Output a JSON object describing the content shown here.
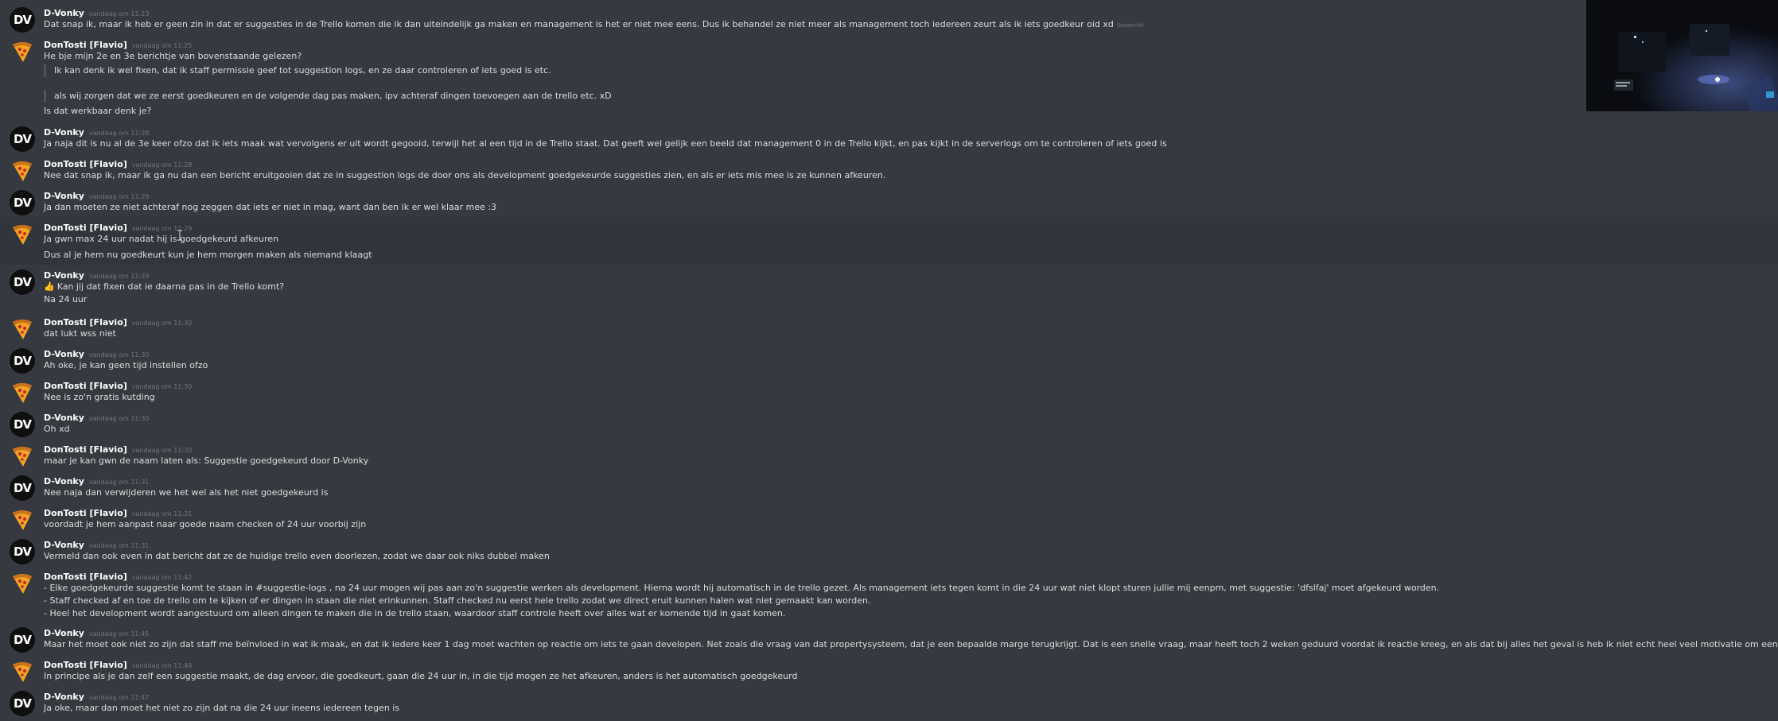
{
  "authors": {
    "dv": {
      "name": "D-Vonky",
      "avatar": "DV"
    },
    "df": {
      "name": "DonTosti [Flavio]",
      "avatar": "pizza-icon"
    }
  },
  "messages": [
    {
      "author": "D-Vonky",
      "time": "vandaag om 11:23",
      "lines": [
        "Dat snap ik, maar ik heb er geen zin in dat er suggesties in de Trello komen die ik dan uiteindelijk ga maken en management is het er niet mee eens. Dus ik behandel ze niet meer als management toch iedereen zeurt als ik iets goedkeur oid xd"
      ],
      "edited": "(bewerkt)"
    },
    {
      "author": "DonTosti [Flavio]",
      "time": "vandaag om 11:25",
      "lines": [
        "He bje mijn 2e en 3e berichtje van bovenstaande gelezen?"
      ],
      "quotes": [
        "Ik kan denk ik wel fixen, dat ik staff permissie geef tot suggestion logs, en ze daar controleren of iets goed is etc.",
        "als wij zorgen dat we ze eerst goedkeuren en de volgende dag pas maken, ipv achteraf dingen toevoegen aan de trello etc. xD"
      ],
      "after": "Is dat werkbaar denk je?"
    },
    {
      "author": "D-Vonky",
      "time": "vandaag om 11:28",
      "lines": [
        "Ja naja dit is nu al de 3e keer ofzo dat ik iets maak wat vervolgens er uit wordt gegooid, terwijl het al een tijd in de Trello staat. Dat geeft wel gelijk een beeld dat management 0 in de Trello kijkt, en pas kijkt in de serverlogs om te controleren of iets goed is"
      ]
    },
    {
      "author": "DonTosti [Flavio]",
      "time": "vandaag om 11:28",
      "lines": [
        "Nee dat snap ik, maar ik ga nu dan een bericht eruitgooien dat ze in suggestion logs de door ons als development goedgekeurde suggesties zien, en als er iets mis mee is ze kunnen afkeuren."
      ]
    },
    {
      "author": "D-Vonky",
      "time": "vandaag om 11:29",
      "lines": [
        "Ja dan moeten ze niet achteraf nog zeggen dat iets er niet in mag, want dan ben ik er wel klaar mee :3"
      ]
    },
    {
      "author": "DonTosti [Flavio]",
      "time": "vandaag om 11:29",
      "lines": [
        "Ja gwn max 24 uur nadat hij is goedgekeurd afkeuren",
        "Dus al je hem nu goedkeurt kun je hem morgen maken als niemand klaagt"
      ]
    },
    {
      "author": "D-Vonky",
      "time": "vandaag om 11:29",
      "lines": [
        "Kan jij dat fixen dat ie daarna pas in de Trello komt?",
        "Na 24 uur"
      ],
      "emoji": "👍"
    },
    {
      "author": "DonTosti [Flavio]",
      "time": "vandaag om 11:30",
      "lines": [
        "dat lukt wss niet"
      ]
    },
    {
      "author": "D-Vonky",
      "time": "vandaag om 11:30",
      "lines": [
        "Ah oke, je kan geen tijd instellen ofzo"
      ]
    },
    {
      "author": "DonTosti [Flavio]",
      "time": "vandaag om 11:30",
      "lines": [
        "Nee is zo'n gratis kutding"
      ]
    },
    {
      "author": "D-Vonky",
      "time": "vandaag om 11:30",
      "lines": [
        "Oh xd"
      ]
    },
    {
      "author": "DonTosti [Flavio]",
      "time": "vandaag om 11:30",
      "lines": [
        "maar je kan gwn de naam laten als: Suggestie goedgekeurd door D-Vonky"
      ]
    },
    {
      "author": "D-Vonky",
      "time": "vandaag om 11:31",
      "lines": [
        "Nee naja dan verwijderen we het wel als het niet goedgekeurd is"
      ]
    },
    {
      "author": "DonTosti [Flavio]",
      "time": "vandaag om 11:31",
      "lines": [
        "voordadt je hem aanpast naar goede naam checken of 24 uur voorbij zijn"
      ]
    },
    {
      "author": "D-Vonky",
      "time": "vandaag om 11:31",
      "lines": [
        "Vermeld dan ook even in dat bericht dat ze de huidige trello even doorlezen, zodat we daar ook niks dubbel maken"
      ]
    },
    {
      "author": "DonTosti [Flavio]",
      "time": "vandaag om 11:42",
      "lines": [
        "- Elke goedgekeurde suggestie komt te staan in #suggestie-logs , na 24 uur mogen wij pas aan zo'n suggestie werken als development. Hierna wordt hij automatisch in de trello gezet. Als management iets tegen komt in die 24 uur wat niet klopt sturen jullie mij eenpm, met suggestie: 'dfslfaj' moet afgekeurd worden.",
        "- Staff checked af en toe de trello om te kijken of er dingen in staan die niet erinkunnen. Staff checked nu eerst hele trello zodat we direct eruit kunnen halen wat niet gemaakt kan worden.",
        "- Heel het development wordt aangestuurd om alleen dingen te maken die in de trello staan, waardoor staff controle heeft over alles wat er komende tijd in gaat komen."
      ]
    },
    {
      "author": "D-Vonky",
      "time": "vandaag om 11:45",
      "lines": [
        "Maar het moet ook niet zo zijn dat staff me beïnvloed in wat ik maak, en dat ik iedere keer 1 dag moet wachten op reactie om iets te gaan developen. Net zoals die vraag van dat propertysysteem, dat je een bepaalde marge terugkrijgt. Dat is een snelle vraag, maar heeft toch 2 weken geduurd voordat ik reactie kreeg, en als dat bij alles het geval is heb ik niet echt heel veel motivatie om een dagje te gaan developen"
      ]
    },
    {
      "author": "DonTosti [Flavio]",
      "time": "vandaag om 11:46",
      "lines": [
        "In principe als je dan zelf een suggestie maakt, de dag ervoor, die goedkeurt, gaan die 24 uur in, in die tijd mogen ze het afkeuren, anders is het automatisch goedgekeurd"
      ]
    },
    {
      "author": "D-Vonky",
      "time": "vandaag om 11:47",
      "lines": [
        "Ja oke, maar dan moet het niet zo zijn dat na die 24 uur ineens iedereen tegen is"
      ]
    },
    {
      "author": "DonTosti [Flavio]",
      "time": "",
      "lines": []
    }
  ]
}
